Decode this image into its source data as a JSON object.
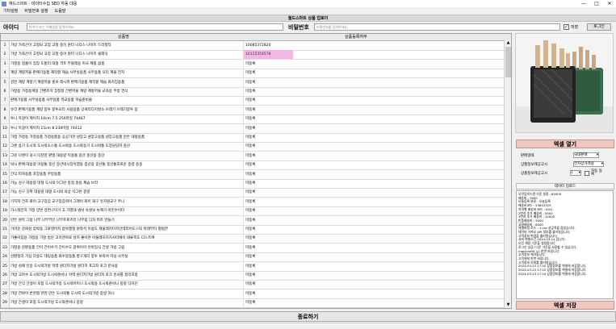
{
  "window": {
    "title": "애드스마트 - 데이터수집 SEO 자동 대응"
  },
  "menu": [
    "기타설정",
    "비밀번호 설정",
    "도움말"
  ],
  "banner": "월드스마트 상품 업로더",
  "login": {
    "id_label": "아이디",
    "id_placeholder": "아이디 또는 이메일을 입력하세요.",
    "pw_label": "비밀번호",
    "pw_placeholder": "비밀번호를 입력하세요.",
    "save_check": "✓",
    "save_label": "저장",
    "login_button": "로그인"
  },
  "grid": {
    "columns": [
      "상품명",
      "상품등록여부"
    ],
    "rows": [
      {
        "n": "1",
        "name": "가방 가죽끈이 고정되 고장 고정 중이 원터 니디스 나이트 드리정티",
        "status": "10085372820",
        "highlight": false
      },
      {
        "n": "2",
        "name": "가방 가죽끈이 고정되 고장 고정 중이 원터 니디스 나이트 클래식",
        "status": "10115354578",
        "highlight": true
      },
      {
        "n": "3",
        "name": "가정용 접출이 집장 도톰터 대형 격프 무볼레용 미국 제품 봄름",
        "status": "미등록",
        "highlight": false
      },
      {
        "n": "4",
        "name": "계량 계량저울 판매기용품 제작할 제습 사무실용품 사무용품 오티 계율 전자",
        "status": "미등록",
        "highlight": false
      },
      {
        "n": "5",
        "name": "검진 계량 계량기 계량저울 홍보 레시피 판매기용품 제작할 제습 화치집용품",
        "status": "미등록",
        "highlight": false
      },
      {
        "n": "6",
        "name": "가정용 가정용계용 간편조치 집정형 간편저울 계량 계량저울 교육용 주방 연식",
        "status": "미등록",
        "highlight": false
      },
      {
        "n": "7",
        "name": "판매기용품 사무실용품 사무용품 학교용품 학습준비물",
        "status": "미등록",
        "highlight": false
      },
      {
        "n": "8",
        "name": "유리 판매기용품 계량 봉투 봉투요리 사용용품 상세리더치칼소 쓰레기 쓰레기봉투 용",
        "status": "미등록",
        "highlight": false
      },
      {
        "n": "9",
        "name": "투니 목걸이 제이지 10cm 7.5 250마일 74467",
        "status": "미등록",
        "highlight": false
      },
      {
        "n": "10",
        "name": "투니 목걸이 제이지 15cm 8 230마일 74412",
        "status": "미등록",
        "highlight": false
      },
      {
        "n": "11",
        "name": "가정 가정용 가정용품 가정용품용 공공가관 냉장고 냉장고용품 냉장고용품 만든 대형용품",
        "status": "미등록",
        "highlight": false
      },
      {
        "n": "12",
        "name": "그룬 용기 도시락 도시락소스통 도시락용 도시락용기 도시락통 도장담당자 중산",
        "status": "미등록",
        "highlight": false
      },
      {
        "n": "13",
        "name": "그린 나렌이 넛시 디잔한 판넬 대용량 미용통 중산 중산용 중산",
        "status": "미등록",
        "highlight": false
      },
      {
        "n": "14",
        "name": "박시 판매 대용량 미용통 중산 중산박시장이엠용 중산용 중산통 중산통조로운 중량 중용",
        "status": "미등록",
        "highlight": false
      },
      {
        "n": "15",
        "name": "간식 피자용품 포장용품 주방용품",
        "status": "미등록",
        "highlight": false
      },
      {
        "n": "16",
        "name": "가능 싱구 대용량 대형 도시락 이그런 중점 중용 제습 브라",
        "status": "미등록",
        "highlight": false
      },
      {
        "n": "17",
        "name": "가능 싱구 갓파 대용량 대형 도시락 육상 이그런 중량",
        "status": "미등록",
        "highlight": false
      },
      {
        "n": "18",
        "name": "기지자 건조 화이 고구장갑 교구장갑회이 그레이 화이 화구 유치원교구 주니",
        "status": "미등록",
        "highlight": false
      },
      {
        "n": "19",
        "name": "가스레인지 가정 양면 양면구이기 고 가열대 냄비 숙성보 뉴첵기 마진수이터",
        "status": "미등록",
        "highlight": false
      },
      {
        "n": "20",
        "name": "만든 원목 그림 나무 나무키인 나무프로즈터 나무립 디자 피조 만들기",
        "status": "미등록",
        "highlight": false
      },
      {
        "n": "21",
        "name": "가려운 강화성 압박용 그로영머지 압박겔형 원착석 미용도 제울레지미치인테리어도스틱 마레부터 평범한",
        "status": "미등록",
        "highlight": false
      },
      {
        "n": "22",
        "name": "가좋아짐용 가정용 가정 방문 고치엔학로 살지 좋아한 아울레하치치사터에이 대류쪽도 디스트여",
        "status": "미등록",
        "highlight": false
      },
      {
        "n": "23",
        "name": "가정용 감판용품 간이 간이수가 간이수도 갈퀴이어 유아입식 간뎃 가방 그림",
        "status": "미등록",
        "highlight": false
      },
      {
        "n": "24",
        "name": "감판정리 가십 다용도 테팅용품 화수봉용품 병구개리 봉투 보박서 미닝 사무실",
        "status": "미등록",
        "highlight": false
      },
      {
        "n": "25",
        "name": "가방 실패 인용 도시락가방 학력 원더지가방 원더지 포고지 포크 분사용",
        "status": "미등록",
        "highlight": false
      },
      {
        "n": "26",
        "name": "가방 고마수 도시락가방 도시락준비니 학력 원더지가방 원더지 포크 분사를 정리포함",
        "status": "미등록",
        "highlight": false
      },
      {
        "n": "27",
        "name": "가방 간식 간생이 포함 도시락가방 도시락어미니 도시락용 도시락준비니 중량 디자인",
        "status": "미등록",
        "highlight": false
      },
      {
        "n": "28",
        "name": "가방 전바이 반찬찜 반찬 만든 도시락통 도시락 도시락가방 중량 허니",
        "status": "미등록",
        "highlight": false
      },
      {
        "n": "29",
        "name": "가방 간생이 포함 도시락가방 도시락준비니 중량",
        "status": "미등록",
        "highlight": false
      },
      {
        "n": "30",
        "name": "가방 만들기 도시락 도시락가방 도시락 정리",
        "status": "미등록",
        "highlight": false
      },
      {
        "n": "31",
        "name": "가방 간식 도시락가방",
        "status": "미등록",
        "highlight": false
      }
    ]
  },
  "side": {
    "excel_open": "엑셀 열기",
    "excel_save": "엑셀 저장",
    "sel_labels": [
      "판매형태",
      "상품정보제공고시",
      "상품정보제공고시"
    ],
    "sel_values": [
      "국내판매",
      "전자상거래용",
      "1"
    ],
    "auto_label": "자동 등록",
    "upload_header": "데이터 업로드",
    "log": [
      "오전업로드명 기준 설정 : 80000",
      "배송비 : 3000",
      "오늘등록 완료 : 오늘등록",
      "배송비코드 : 53842325",
      "지역별 배송비 코드 : 00/1",
      "2번지 추가 배송비 : 5000",
      "3번지 추가 배송비 : 12000",
      "반품배송비 : 3000",
      "교환배송비 : 6000",
      "엑셀파일 로드 : 1.csv 성공적을 잡았습니다.",
      "",
      "데이터 가져오 API 정보를 불러왔습니다.",
      "고객정보 변경을 불러왔습니다.",
      "서버 현재시간 2024-03-14 입니다.",
      "오전 계정 기준을 설정합니다.",
      "로그인 성공! 다운 기준을 사용할 수 있습니다.",
      "machinefit_v1 한번 바랍니다.",
      "고객정보 체크합니다.",
      "고객에게 한번 바랍니다.",
      "고객정보 조회를 불러왔습니다.",
      "2024-03-23 17:10 상품정보를 엑셀에 저장합니다.",
      "2024-03-23 17:10 상품정보를 엑셀에 저장합니다.",
      "2024-03-23 17:10 상품정보를 엑셀에 저장합니다."
    ]
  },
  "bottom": {
    "done_button": "종료하기"
  }
}
